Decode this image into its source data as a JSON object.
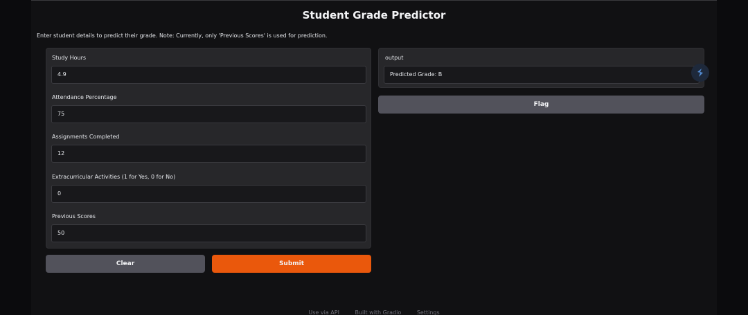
{
  "title": "Student Grade Predictor",
  "description": "Enter student details to predict their grade. Note: Currently, only 'Previous Scores' is used for prediction.",
  "inputs": [
    {
      "label": "Study Hours",
      "value": "4.9"
    },
    {
      "label": "Attendance Percentage",
      "value": "75"
    },
    {
      "label": "Assignments Completed",
      "value": "12"
    },
    {
      "label": "Extracurricular Activities (1 for Yes, 0 for No)",
      "value": "0"
    },
    {
      "label": "Previous Scores",
      "value": "50"
    }
  ],
  "output": {
    "label": "output",
    "value": "Predicted Grade: B"
  },
  "buttons": {
    "flag": "Flag",
    "clear": "Clear",
    "submit": "Submit"
  },
  "footer": {
    "api": "Use via API",
    "built": "Built with Gradio",
    "settings": "Settings"
  },
  "colors": {
    "submit": "#ea580c",
    "secondary": "#52525b",
    "panel": "#27272a",
    "background": "#111113"
  },
  "icons": {
    "floating": "gradio-logo-icon"
  }
}
